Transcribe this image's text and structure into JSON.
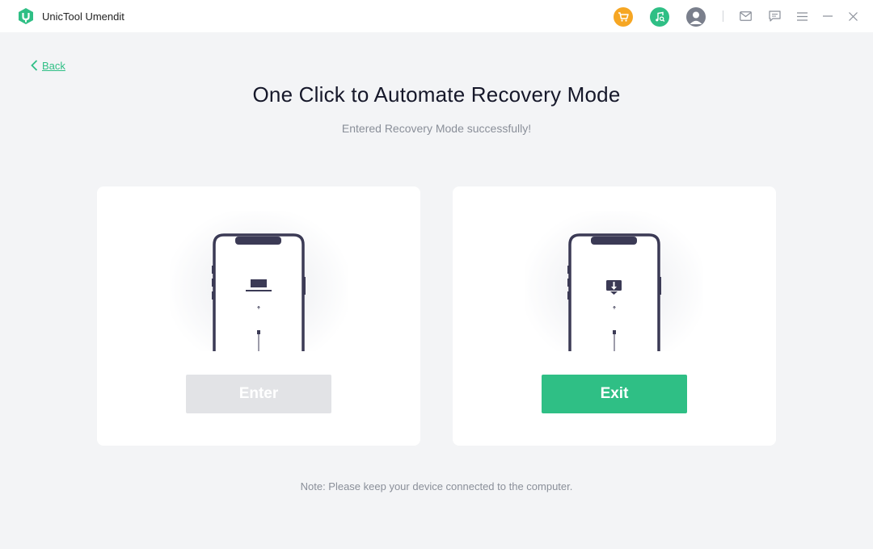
{
  "app": {
    "title": "UnicTool Umendit",
    "accent_color": "#2fbf85"
  },
  "titlebar": {
    "icons": [
      "cart-icon",
      "music-icon",
      "user-avatar",
      "mail-icon",
      "chat-icon",
      "menu-icon",
      "minimize-icon",
      "close-icon"
    ]
  },
  "nav": {
    "back_label": "Back"
  },
  "main": {
    "title": "One Click to Automate Recovery Mode",
    "subtitle": "Entered Recovery Mode successfully!",
    "cards": [
      {
        "button_label": "Enter",
        "enabled": false,
        "screen_icon": "laptop-icon"
      },
      {
        "button_label": "Exit",
        "enabled": true,
        "screen_icon": "download-monitor-icon"
      }
    ],
    "note": "Note: Please keep your device connected to the computer."
  }
}
